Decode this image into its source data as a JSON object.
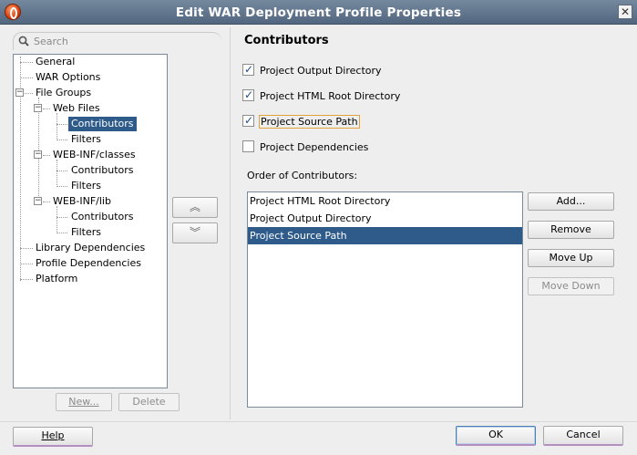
{
  "window": {
    "title": "Edit WAR Deployment Profile Properties",
    "close_glyph": "✕"
  },
  "search": {
    "placeholder": "Search",
    "value": ""
  },
  "tree": [
    {
      "label": "General",
      "depth": 0,
      "selected": false
    },
    {
      "label": "WAR Options",
      "depth": 0,
      "selected": false
    },
    {
      "label": "File Groups",
      "depth": 0,
      "expanded": true,
      "selected": false
    },
    {
      "label": "Web Files",
      "depth": 1,
      "expanded": true,
      "selected": false
    },
    {
      "label": "Contributors",
      "depth": 2,
      "selected": true
    },
    {
      "label": "Filters",
      "depth": 2,
      "selected": false
    },
    {
      "label": "WEB-INF/classes",
      "depth": 1,
      "expanded": true,
      "selected": false
    },
    {
      "label": "Contributors",
      "depth": 2,
      "selected": false
    },
    {
      "label": "Filters",
      "depth": 2,
      "selected": false
    },
    {
      "label": "WEB-INF/lib",
      "depth": 1,
      "expanded": true,
      "selected": false
    },
    {
      "label": "Contributors",
      "depth": 2,
      "selected": false
    },
    {
      "label": "Filters",
      "depth": 2,
      "selected": false
    },
    {
      "label": "Library Dependencies",
      "depth": 0,
      "selected": false
    },
    {
      "label": "Profile Dependencies",
      "depth": 0,
      "selected": false
    },
    {
      "label": "Platform",
      "depth": 0,
      "selected": false
    }
  ],
  "tree_buttons": {
    "new_label": "New...",
    "delete_label": "Delete"
  },
  "arrows": {
    "up_glyph": "︽",
    "down_glyph": "︾"
  },
  "contributors": {
    "title": "Contributors",
    "options": [
      {
        "label": "Project Output Directory",
        "checked": true
      },
      {
        "label": "Project HTML Root Directory",
        "checked": true
      },
      {
        "label": "Project Source Path",
        "checked": true,
        "focused": true
      },
      {
        "label": "Project Dependencies",
        "checked": false
      }
    ],
    "order_label": "Order of Contributors:",
    "order_items": [
      {
        "label": "Project HTML Root Directory",
        "selected": false
      },
      {
        "label": "Project Output Directory",
        "selected": false
      },
      {
        "label": "Project Source Path",
        "selected": true
      }
    ],
    "add_label": "Add...",
    "remove_label": "Remove",
    "move_up_label": "Move Up",
    "move_down_label": "Move Down"
  },
  "footer": {
    "help_label": "Help",
    "ok_label": "OK",
    "cancel_label": "Cancel"
  },
  "colors": {
    "selection": "#2e5b8a",
    "titlebar": "#5e7289",
    "focus_border": "#e3a13a"
  }
}
